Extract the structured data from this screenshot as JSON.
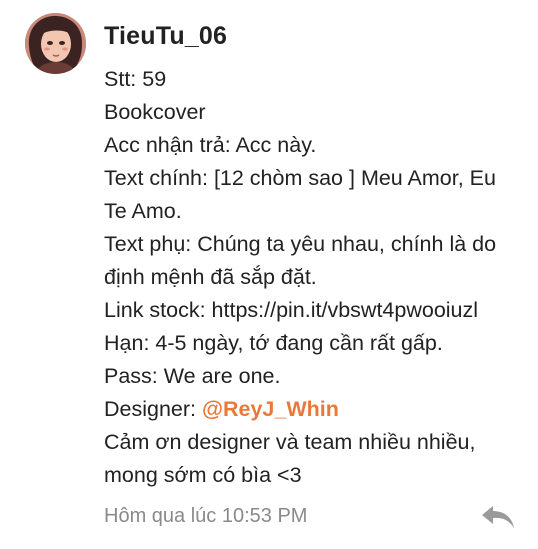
{
  "comment": {
    "username": "TieuTu_06",
    "lines": {
      "stt": "Stt: 59",
      "type": "Bookcover",
      "acc": "Acc nhận trả: Acc này.",
      "text_main_1": "Text chính: [12 chòm sao ] Meu Amor, Eu",
      "text_main_2": "Te Amo.",
      "text_sub_1": "Text phụ: Chúng ta yêu nhau, chính là do",
      "text_sub_2": "định mệnh đã sắp đặt.",
      "link": "Link stock: https://pin.it/vbswt4pwooiuzl",
      "deadline": "Hạn: 4-5 ngày, tớ đang cần rất gấp.",
      "pass": "Pass: We are one.",
      "designer_label": "Designer: ",
      "designer_mention": "@ReyJ_Whin",
      "thanks_1": "Cảm ơn designer và team nhiều nhiều,",
      "thanks_2": "mong sớm có bìa <3"
    },
    "timestamp": "Hôm qua lúc 10:53 PM",
    "reply_icon": "reply-arrow-icon",
    "mention_color": "#e9793a"
  }
}
